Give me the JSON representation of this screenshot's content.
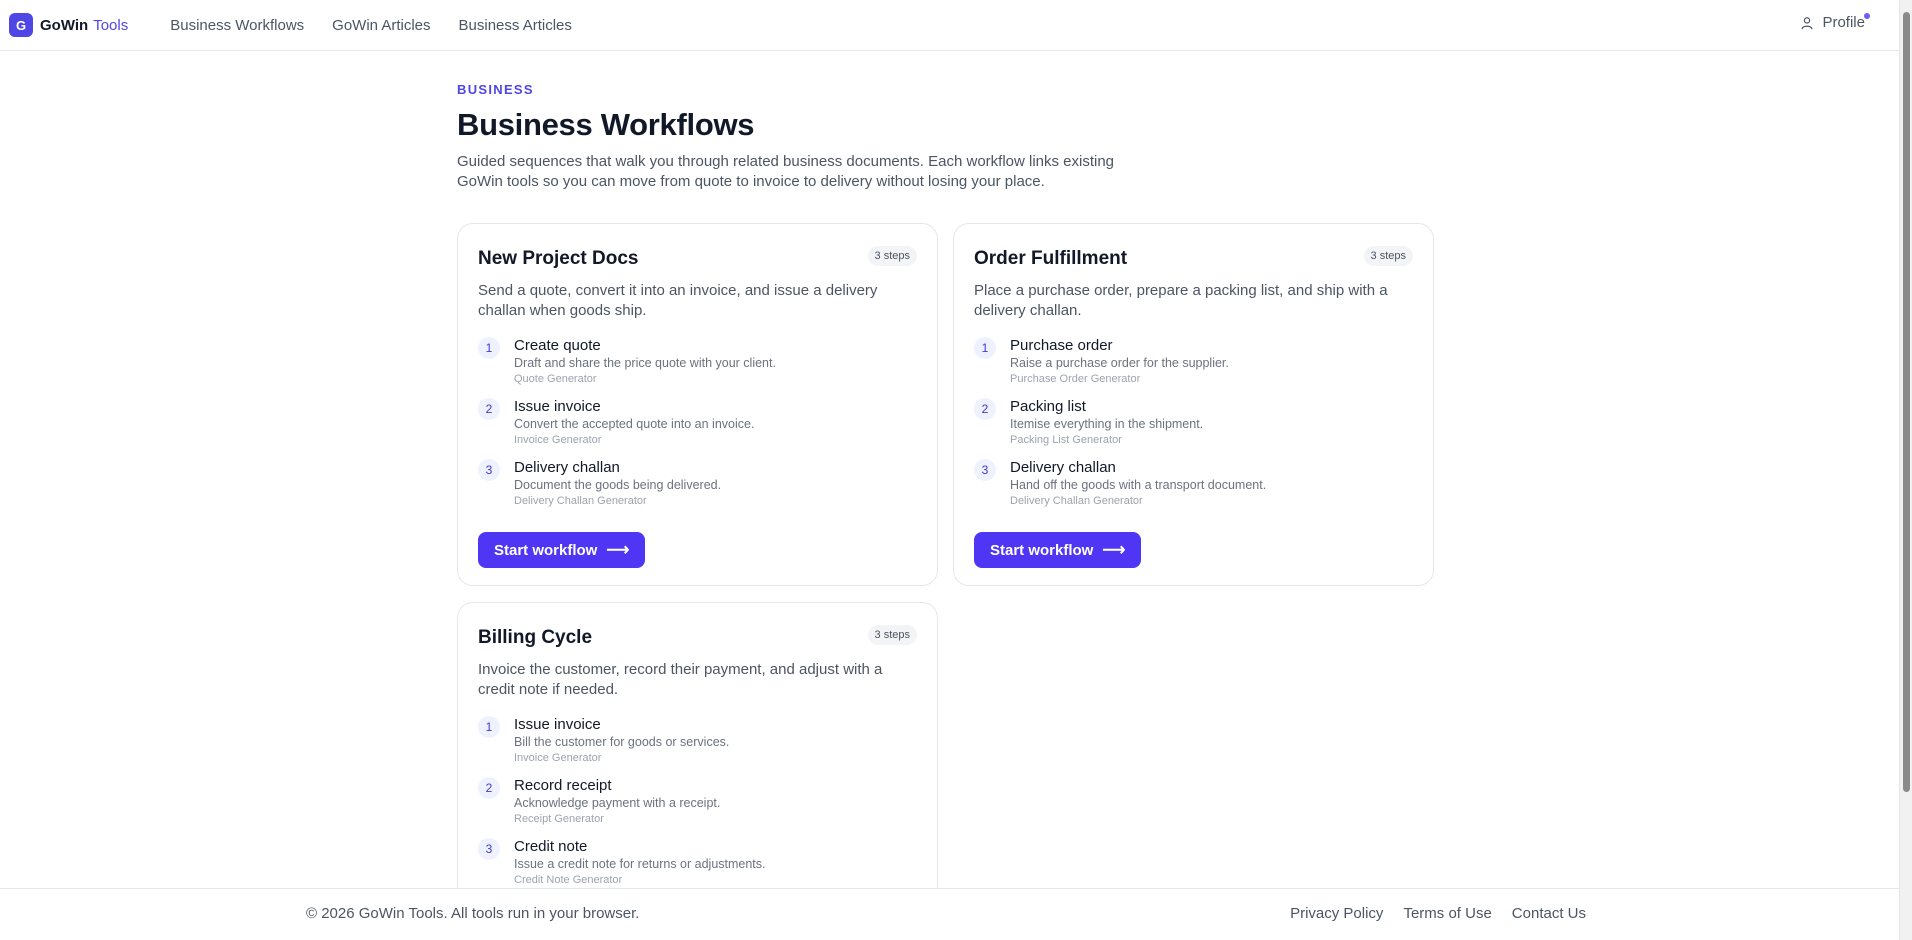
{
  "header": {
    "logo_letter": "G",
    "brand_name": "GoWin",
    "brand_sub": "Tools",
    "nav": [
      "Business Workflows",
      "GoWin Articles",
      "Business Articles"
    ],
    "profile_label": "Profile"
  },
  "page": {
    "eyebrow": "BUSINESS",
    "title": "Business Workflows",
    "intro": "Guided sequences that walk you through related business documents. Each workflow links existing GoWin tools so you can move from quote to invoice to delivery without losing your place."
  },
  "workflows": [
    {
      "title": "New Project Docs",
      "badge": "3 steps",
      "desc": "Send a quote, convert it into an invoice, and issue a delivery challan when goods ship.",
      "steps": [
        {
          "num": "1",
          "title": "Create quote",
          "desc": "Draft and share the price quote with your client.",
          "tool": "Quote Generator"
        },
        {
          "num": "2",
          "title": "Issue invoice",
          "desc": "Convert the accepted quote into an invoice.",
          "tool": "Invoice Generator"
        },
        {
          "num": "3",
          "title": "Delivery challan",
          "desc": "Document the goods being delivered.",
          "tool": "Delivery Challan Generator"
        }
      ],
      "button": "Start workflow"
    },
    {
      "title": "Order Fulfillment",
      "badge": "3 steps",
      "desc": "Place a purchase order, prepare a packing list, and ship with a delivery challan.",
      "steps": [
        {
          "num": "1",
          "title": "Purchase order",
          "desc": "Raise a purchase order for the supplier.",
          "tool": "Purchase Order Generator"
        },
        {
          "num": "2",
          "title": "Packing list",
          "desc": "Itemise everything in the shipment.",
          "tool": "Packing List Generator"
        },
        {
          "num": "3",
          "title": "Delivery challan",
          "desc": "Hand off the goods with a transport document.",
          "tool": "Delivery Challan Generator"
        }
      ],
      "button": "Start workflow"
    },
    {
      "title": "Billing Cycle",
      "badge": "3 steps",
      "desc": "Invoice the customer, record their payment, and adjust with a credit note if needed.",
      "steps": [
        {
          "num": "1",
          "title": "Issue invoice",
          "desc": "Bill the customer for goods or services.",
          "tool": "Invoice Generator"
        },
        {
          "num": "2",
          "title": "Record receipt",
          "desc": "Acknowledge payment with a receipt.",
          "tool": "Receipt Generator"
        },
        {
          "num": "3",
          "title": "Credit note",
          "desc": "Issue a credit note for returns or adjustments.",
          "tool": "Credit Note Generator"
        }
      ]
    }
  ],
  "footer": {
    "copyright": "© 2026 GoWin Tools. All tools run in your browser.",
    "links": [
      "Privacy Policy",
      "Terms of Use",
      "Contact Us"
    ]
  },
  "colors": {
    "accent": "#4f46e5",
    "button": "#4f36f5"
  }
}
